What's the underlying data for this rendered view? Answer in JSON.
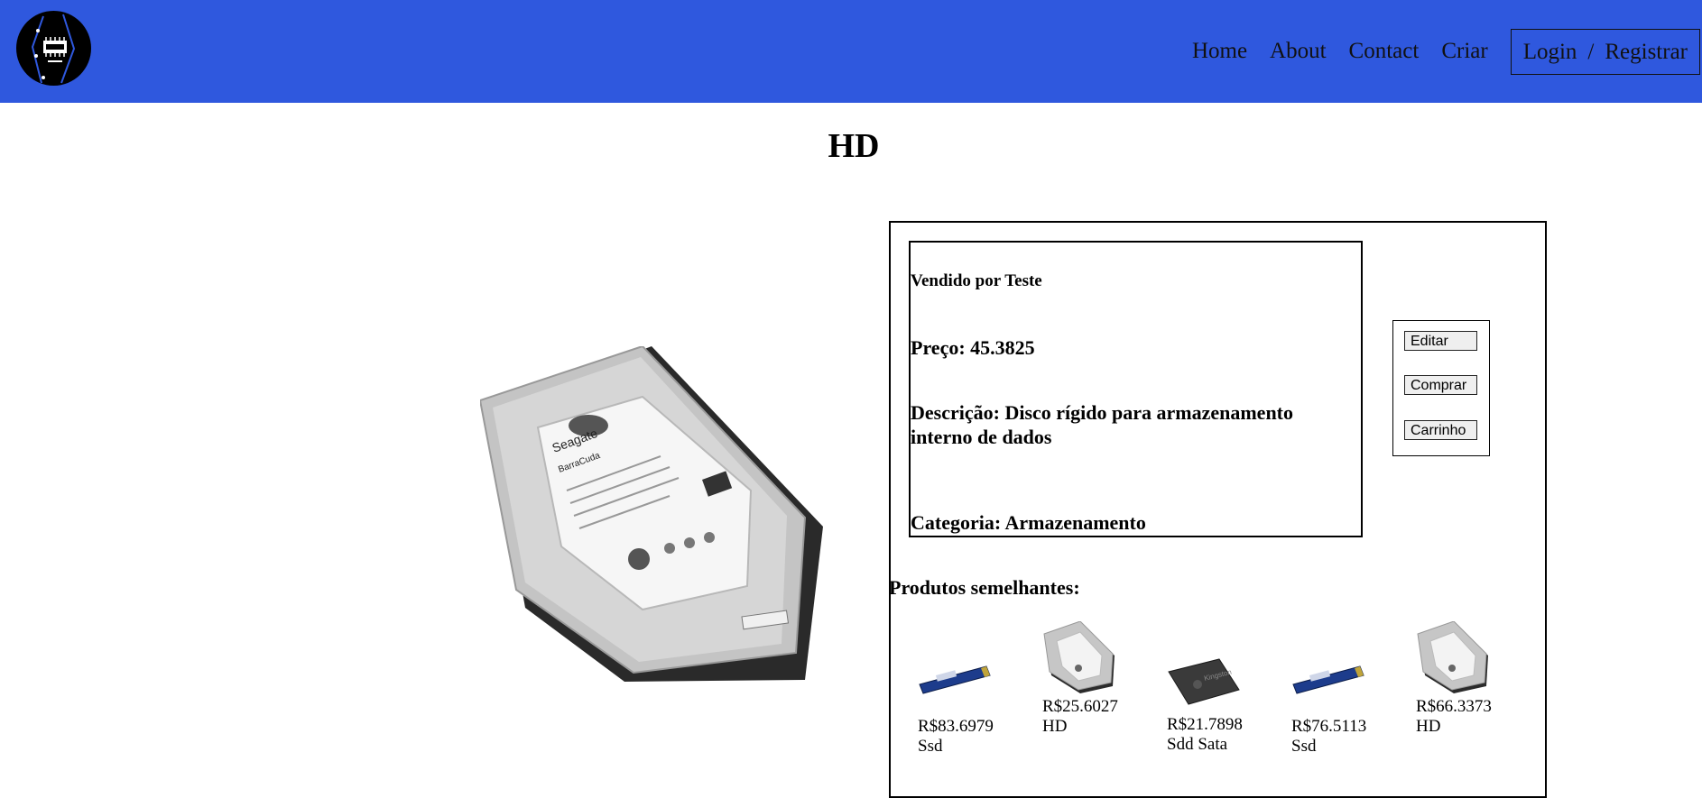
{
  "header": {
    "nav": [
      "Home",
      "About",
      "Contact",
      "Criar"
    ],
    "login_label": "Login",
    "separator": "/",
    "register_label": "Registrar",
    "background": "#2f58de"
  },
  "product": {
    "title": "HD",
    "seller": "Vendido por Teste",
    "price": "Preço: 45.3825",
    "description": "Descrição: Disco rígido para armazenamento interno de dados",
    "category": "Categoria: Armazenamento",
    "image_icon": "hard-drive-image"
  },
  "actions": {
    "edit": "Editar",
    "buy": "Comprar",
    "cart": "Carrinho"
  },
  "similar": {
    "title": "Produtos semelhantes:",
    "items": [
      {
        "price": "R$83.6979",
        "name": "Ssd",
        "icon": "nvme-ssd-thumbnail"
      },
      {
        "price": "R$25.6027",
        "name": "HD",
        "icon": "hard-drive-thumbnail"
      },
      {
        "price": "R$21.7898",
        "name": "Sdd Sata",
        "icon": "sata-ssd-thumbnail"
      },
      {
        "price": "R$76.5113",
        "name": "Ssd",
        "icon": "nvme-ssd-thumbnail"
      },
      {
        "price": "R$66.3373",
        "name": "HD",
        "icon": "hard-drive-thumbnail"
      }
    ]
  }
}
